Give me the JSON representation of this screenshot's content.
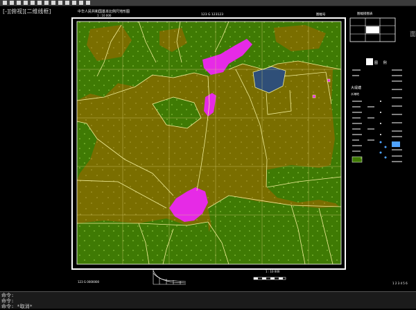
{
  "viewport": {
    "label": "[-][俯视][二维线框]",
    "right_edge_text": "面"
  },
  "map": {
    "title": "中华人民共和国基本比例尺地形图",
    "top_small_left": "1 : 10 000",
    "top_center": "123  G  123123",
    "top_right": "图幅号",
    "bottom_left": "123 G 0000000",
    "bottom_center": "1 : 10 000",
    "bottom_right": "1 2 3 4 5 6"
  },
  "legend": {
    "panel_title": "图幅接图表",
    "title": "图  例",
    "item_large_label": "大堤塘",
    "item_label_2": "水淹地",
    "colors": {
      "forest": "#3f7a04",
      "grass": "#7a6e00",
      "settlement": "#e62ae6",
      "water": "#2f4f78",
      "lines": "#f2ef9a"
    }
  },
  "command": {
    "line1": "命令:",
    "line2": "命令:",
    "line3": "命令: *取消*"
  }
}
